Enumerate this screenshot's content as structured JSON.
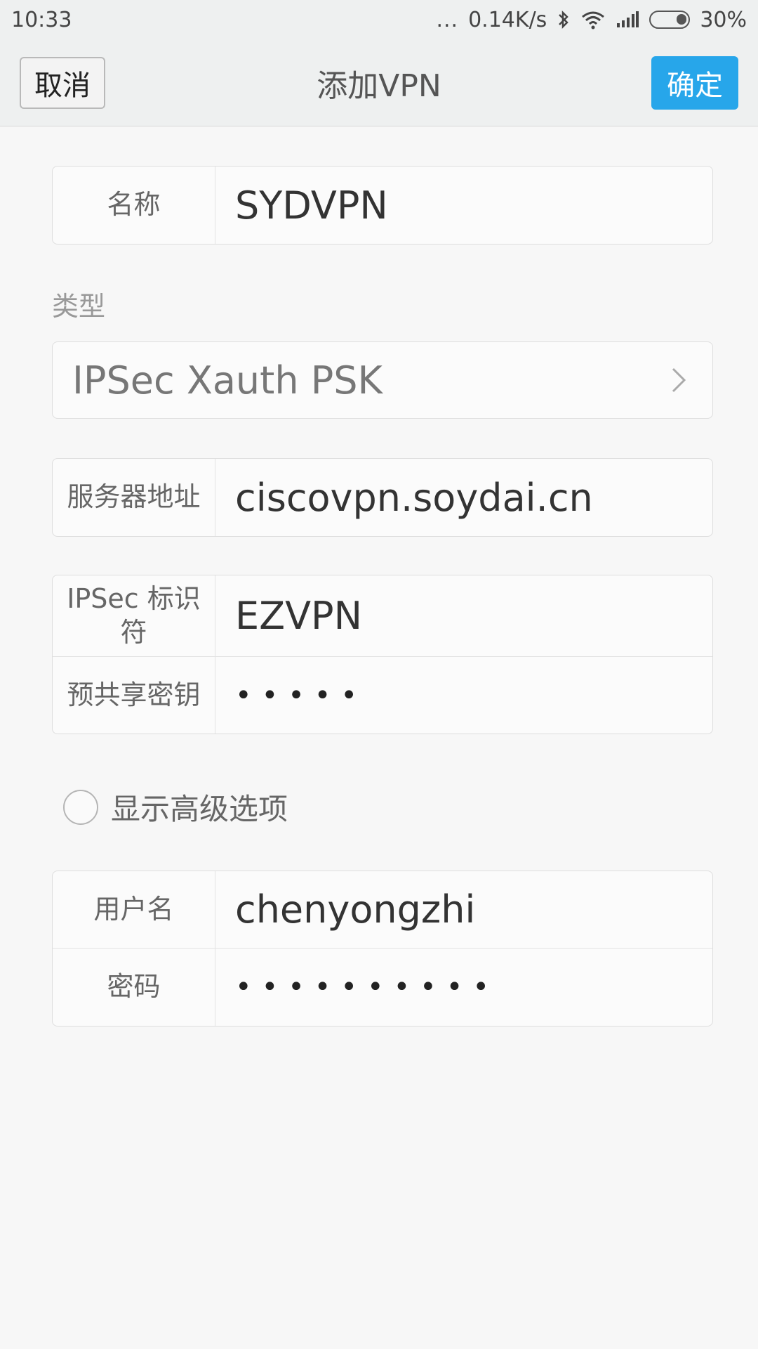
{
  "status_bar": {
    "time": "10:33",
    "dots": "...",
    "speed": "0.14K/s",
    "battery_pct": "30%",
    "battery_level": 0.3
  },
  "header": {
    "cancel_label": "取消",
    "title": "添加VPN",
    "ok_label": "确定",
    "accent_color": "#27a6ea"
  },
  "form": {
    "name": {
      "label": "名称",
      "value": "SYDVPN"
    },
    "type_section_label": "类型",
    "type": {
      "value": "IPSec Xauth PSK"
    },
    "server": {
      "label": "服务器地址",
      "value": "ciscovpn.soydai.cn"
    },
    "ipsec_id": {
      "label": "IPSec 标识符",
      "value": "EZVPN"
    },
    "psk": {
      "label": "预共享密钥",
      "value": "•••••"
    },
    "advanced": {
      "label": "显示高级选项",
      "checked": false
    },
    "username": {
      "label": "用户名",
      "value": "chenyongzhi"
    },
    "password": {
      "label": "密码",
      "value": "••••••••••"
    }
  }
}
